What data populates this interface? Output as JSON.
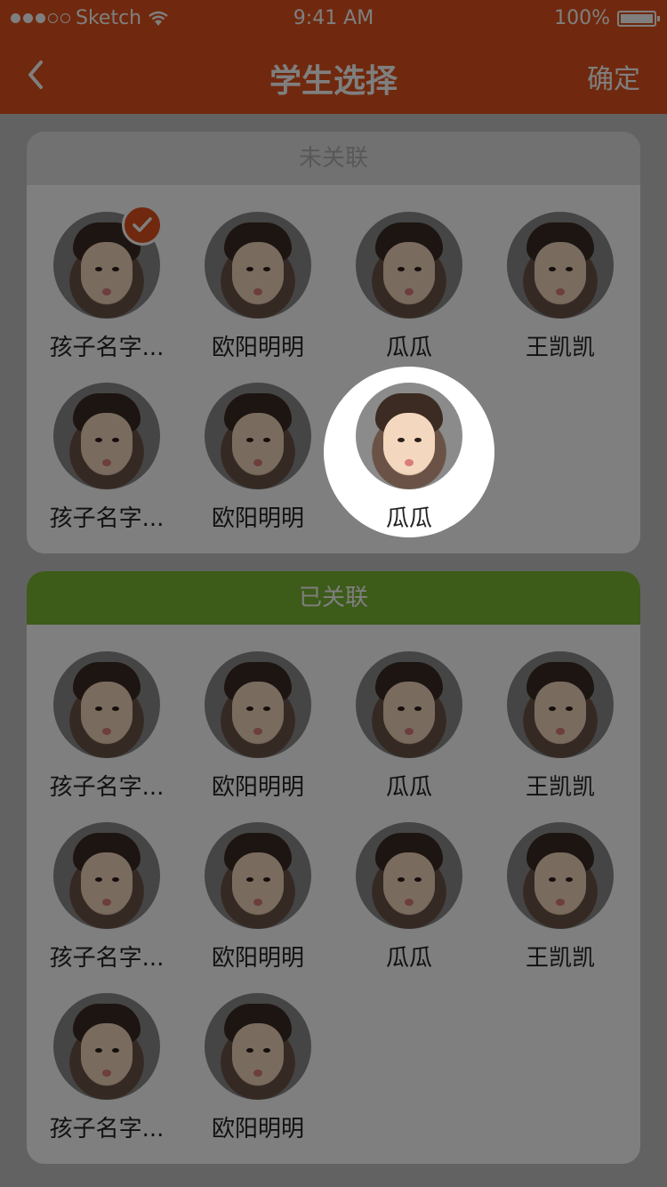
{
  "status_bar": {
    "carrier": "Sketch",
    "time": "9:41 AM",
    "battery": "100%"
  },
  "nav": {
    "title": "学生选择",
    "confirm_label": "确定"
  },
  "sections": [
    {
      "header": "未关联",
      "students": [
        {
          "name": "孩子名字...",
          "selected": true
        },
        {
          "name": "欧阳明明"
        },
        {
          "name": "瓜瓜"
        },
        {
          "name": "王凯凯"
        },
        {
          "name": "孩子名字..."
        },
        {
          "name": "欧阳明明"
        },
        {
          "name": "瓜瓜"
        }
      ]
    },
    {
      "header": "已关联",
      "students": [
        {
          "name": "孩子名字..."
        },
        {
          "name": "欧阳明明"
        },
        {
          "name": "瓜瓜"
        },
        {
          "name": "王凯凯"
        },
        {
          "name": "孩子名字..."
        },
        {
          "name": "欧阳明明"
        },
        {
          "name": "瓜瓜"
        },
        {
          "name": "王凯凯"
        },
        {
          "name": "孩子名字..."
        },
        {
          "name": "欧阳明明"
        }
      ]
    }
  ],
  "highlight": {
    "name": "瓜瓜"
  },
  "colors": {
    "accent": "#e0521c",
    "linked": "#7bb632",
    "unlinked_header": "#e2e2e2"
  },
  "icons": [
    "signal-dots-icon",
    "wifi-icon",
    "battery-icon",
    "back-chevron-icon",
    "checkmark-icon",
    "avatar-photo"
  ]
}
